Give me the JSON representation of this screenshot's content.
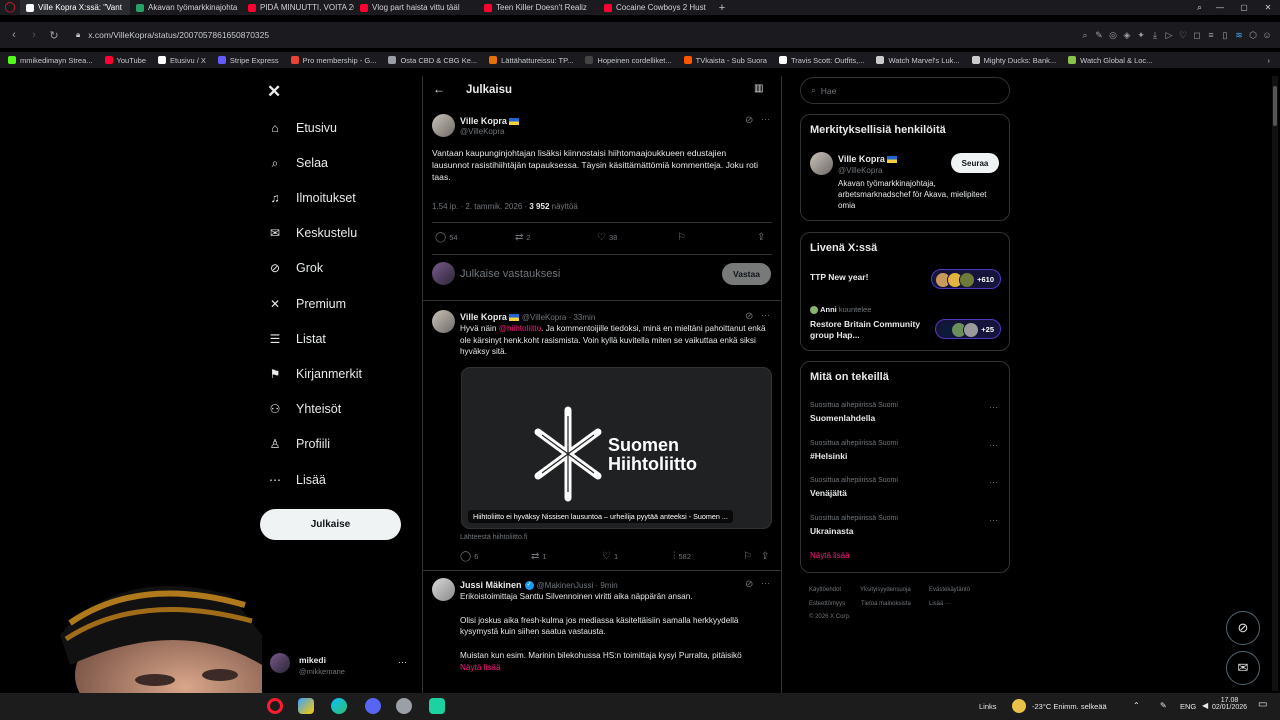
{
  "browser": {
    "tabs": [
      {
        "label": "Ville Kopra X:ssä: \"Vant",
        "color": "#ffffff",
        "active": true
      },
      {
        "label": "Akavan työmarkkinajohta",
        "color": "#26a269"
      },
      {
        "label": "PIDÄ MINUUTTI, VOITA 20",
        "color": "#ff0033"
      },
      {
        "label": "Vlog part haista vittu tääl",
        "color": "#ff0033"
      },
      {
        "label": "Teen Killer Doesn't Realiz",
        "color": "#ff0033"
      },
      {
        "label": "Cocaine Cowboys 2 Hust",
        "color": "#ff0033"
      }
    ],
    "url": "x.com/VilleKopra/status/2007057861650870325",
    "bookmarks": [
      {
        "label": "mmikedimayn Strea...",
        "color": "#53fc18"
      },
      {
        "label": "YouTube",
        "color": "#ff0033"
      },
      {
        "label": "Etusivu / X",
        "color": "#ffffff"
      },
      {
        "label": "Stripe Express",
        "color": "#635bff"
      },
      {
        "label": "Pro membership - G...",
        "color": "#ea4335"
      },
      {
        "label": "Osta CBD & CBG Ke...",
        "color": "#9aa0a6"
      },
      {
        "label": "Lättähattureissu: TP...",
        "color": "#e8710a"
      },
      {
        "label": "Hopeinen cordelliket...",
        "color": "#444444"
      },
      {
        "label": "TVkaista - Sub Suora",
        "color": "#ff5500"
      },
      {
        "label": "Travis Scott: Outfits,...",
        "color": "#ffffff"
      },
      {
        "label": "Watch Marvel's Luk...",
        "color": "#cccccc"
      },
      {
        "label": "Mighty Ducks: Bank...",
        "color": "#cccccc"
      },
      {
        "label": "Watch Global & Loc...",
        "color": "#8bc34a"
      }
    ]
  },
  "sidebar": {
    "items": [
      {
        "label": "Etusivu",
        "icon": "home-icon",
        "glyph": "⌂"
      },
      {
        "label": "Selaa",
        "icon": "search-icon",
        "glyph": "⌕"
      },
      {
        "label": "Ilmoitukset",
        "icon": "bell-icon",
        "glyph": "♫"
      },
      {
        "label": "Keskustelu",
        "icon": "mail-icon",
        "glyph": "✉"
      },
      {
        "label": "Grok",
        "icon": "grok-icon",
        "glyph": "⊘"
      },
      {
        "label": "Premium",
        "icon": "x-logo-icon",
        "glyph": "✕"
      },
      {
        "label": "Listat",
        "icon": "list-icon",
        "glyph": "☰"
      },
      {
        "label": "Kirjanmerkit",
        "icon": "bookmark-icon",
        "glyph": "⚑"
      },
      {
        "label": "Yhteisöt",
        "icon": "communities-icon",
        "glyph": "⚇"
      },
      {
        "label": "Profiili",
        "icon": "profile-icon",
        "glyph": "♙"
      },
      {
        "label": "Lisää",
        "icon": "more-circle-icon",
        "glyph": "⋯"
      }
    ],
    "post_button": "Julkaise",
    "account": {
      "name": "mikedi",
      "handle": "@mikkemane"
    }
  },
  "main": {
    "header_title": "Julkaisu",
    "post": {
      "name": "Ville Kopra",
      "handle": "@VilleKopra",
      "text": "Vantaan kaupunginjohtajan lisäksi kiinnostaisi hiihtomaajoukkueen edustajien lausunnot rasistihiihtäjän tapauksessa. Täysin käsittämättömiä kommentteja. Joku roti taas.",
      "time": "1.54 ip. · 2. tammik. 2026 · ",
      "views": "3 952",
      "views_label": "näyttöä",
      "replies": "54",
      "reposts": "2",
      "likes": "38"
    },
    "reply_box": {
      "placeholder": "Julkaise vastauksesi",
      "button": "Vastaa"
    },
    "reply1": {
      "name": "Ville Kopra",
      "meta": "@VilleKopra · 33min",
      "text_before": "Hyvä näin ",
      "mention": "@hiihtoliitto",
      "text_after": ". Ja kommentoijille tiedoksi, minä en mieltäni pahoittanut enkä ole kärsinyt henk.koht rasismista. Voin kyllä kuvitella miten se vaikuttaa enkä siksi hyväksy sitä.",
      "card_logo_line1": "Suomen",
      "card_logo_line2": "Hiihtoliitto",
      "card_caption": "Hiihtoliitto ei hyväksy Nissisen lausuntoa – urheilija pyytää anteeksi - Suomen ...",
      "card_source": "Lähteestä hiihtoliitto.fi",
      "replies": "6",
      "reposts": "1",
      "likes": "1",
      "views": "582"
    },
    "reply2": {
      "name": "Jussi Mäkinen",
      "meta": "@MakinenJussi · 9min",
      "p1": "Erikoistoimittaja Santtu Silvennoinen viritti aika näppärän ansan.",
      "p2": "Olisi joskus aika fresh-kulma jos mediassa käsiteltäisiin samalla herkkyydellä kysymystä kuin siihen saatua vastausta.",
      "p3": "Muistan kun esim. Marinin bilekohussa HS:n toimittaja kysyi Purralta, pitäisikö",
      "show_more": "Näytä lisää"
    }
  },
  "right": {
    "search_placeholder": "Hae",
    "relevant": {
      "title": "Merkityksellisiä henkilöitä",
      "name": "Ville Kopra",
      "handle": "@VilleKopra",
      "follow": "Seuraa",
      "bio": "Akavan työmarkkinajohtaja, arbetsmarknadschef för Akava, mielipiteet omia"
    },
    "live": {
      "title": "Livenä X:ssä",
      "item1_title": "TTP New year!",
      "item1_count": "+610",
      "item2_host": "Anni",
      "item2_status": "kuuntelee",
      "item2_title": "Restore Britain Community group Hap...",
      "item2_count": "+25"
    },
    "trends": {
      "title": "Mitä on tekeillä",
      "items": [
        {
          "meta": "Suosittua aihepiirissä Suomi",
          "title": "Suomenlahdella"
        },
        {
          "meta": "Suosittua aihepiirissä Suomi",
          "title": "#Helsinki"
        },
        {
          "meta": "Suosittua aihepiirissä Suomi",
          "title": "Venäjältä"
        },
        {
          "meta": "Suosittua aihepiirissä Suomi",
          "title": "Ukrainasta"
        }
      ],
      "show_more": "Näytä lisää"
    },
    "footer": [
      "Käyttöehdot",
      "Yksityisyydensuoja",
      "Evästekäytäntö",
      "Esteettömyys",
      "Tietoa mainoksista",
      "Lisää ···",
      "© 2026 X Corp."
    ]
  },
  "taskbar": {
    "links_label": "Links",
    "weather": "-23°C  Enimm. selkeää",
    "lang": "ENG",
    "time": "17.08",
    "date": "02/01/2026"
  }
}
